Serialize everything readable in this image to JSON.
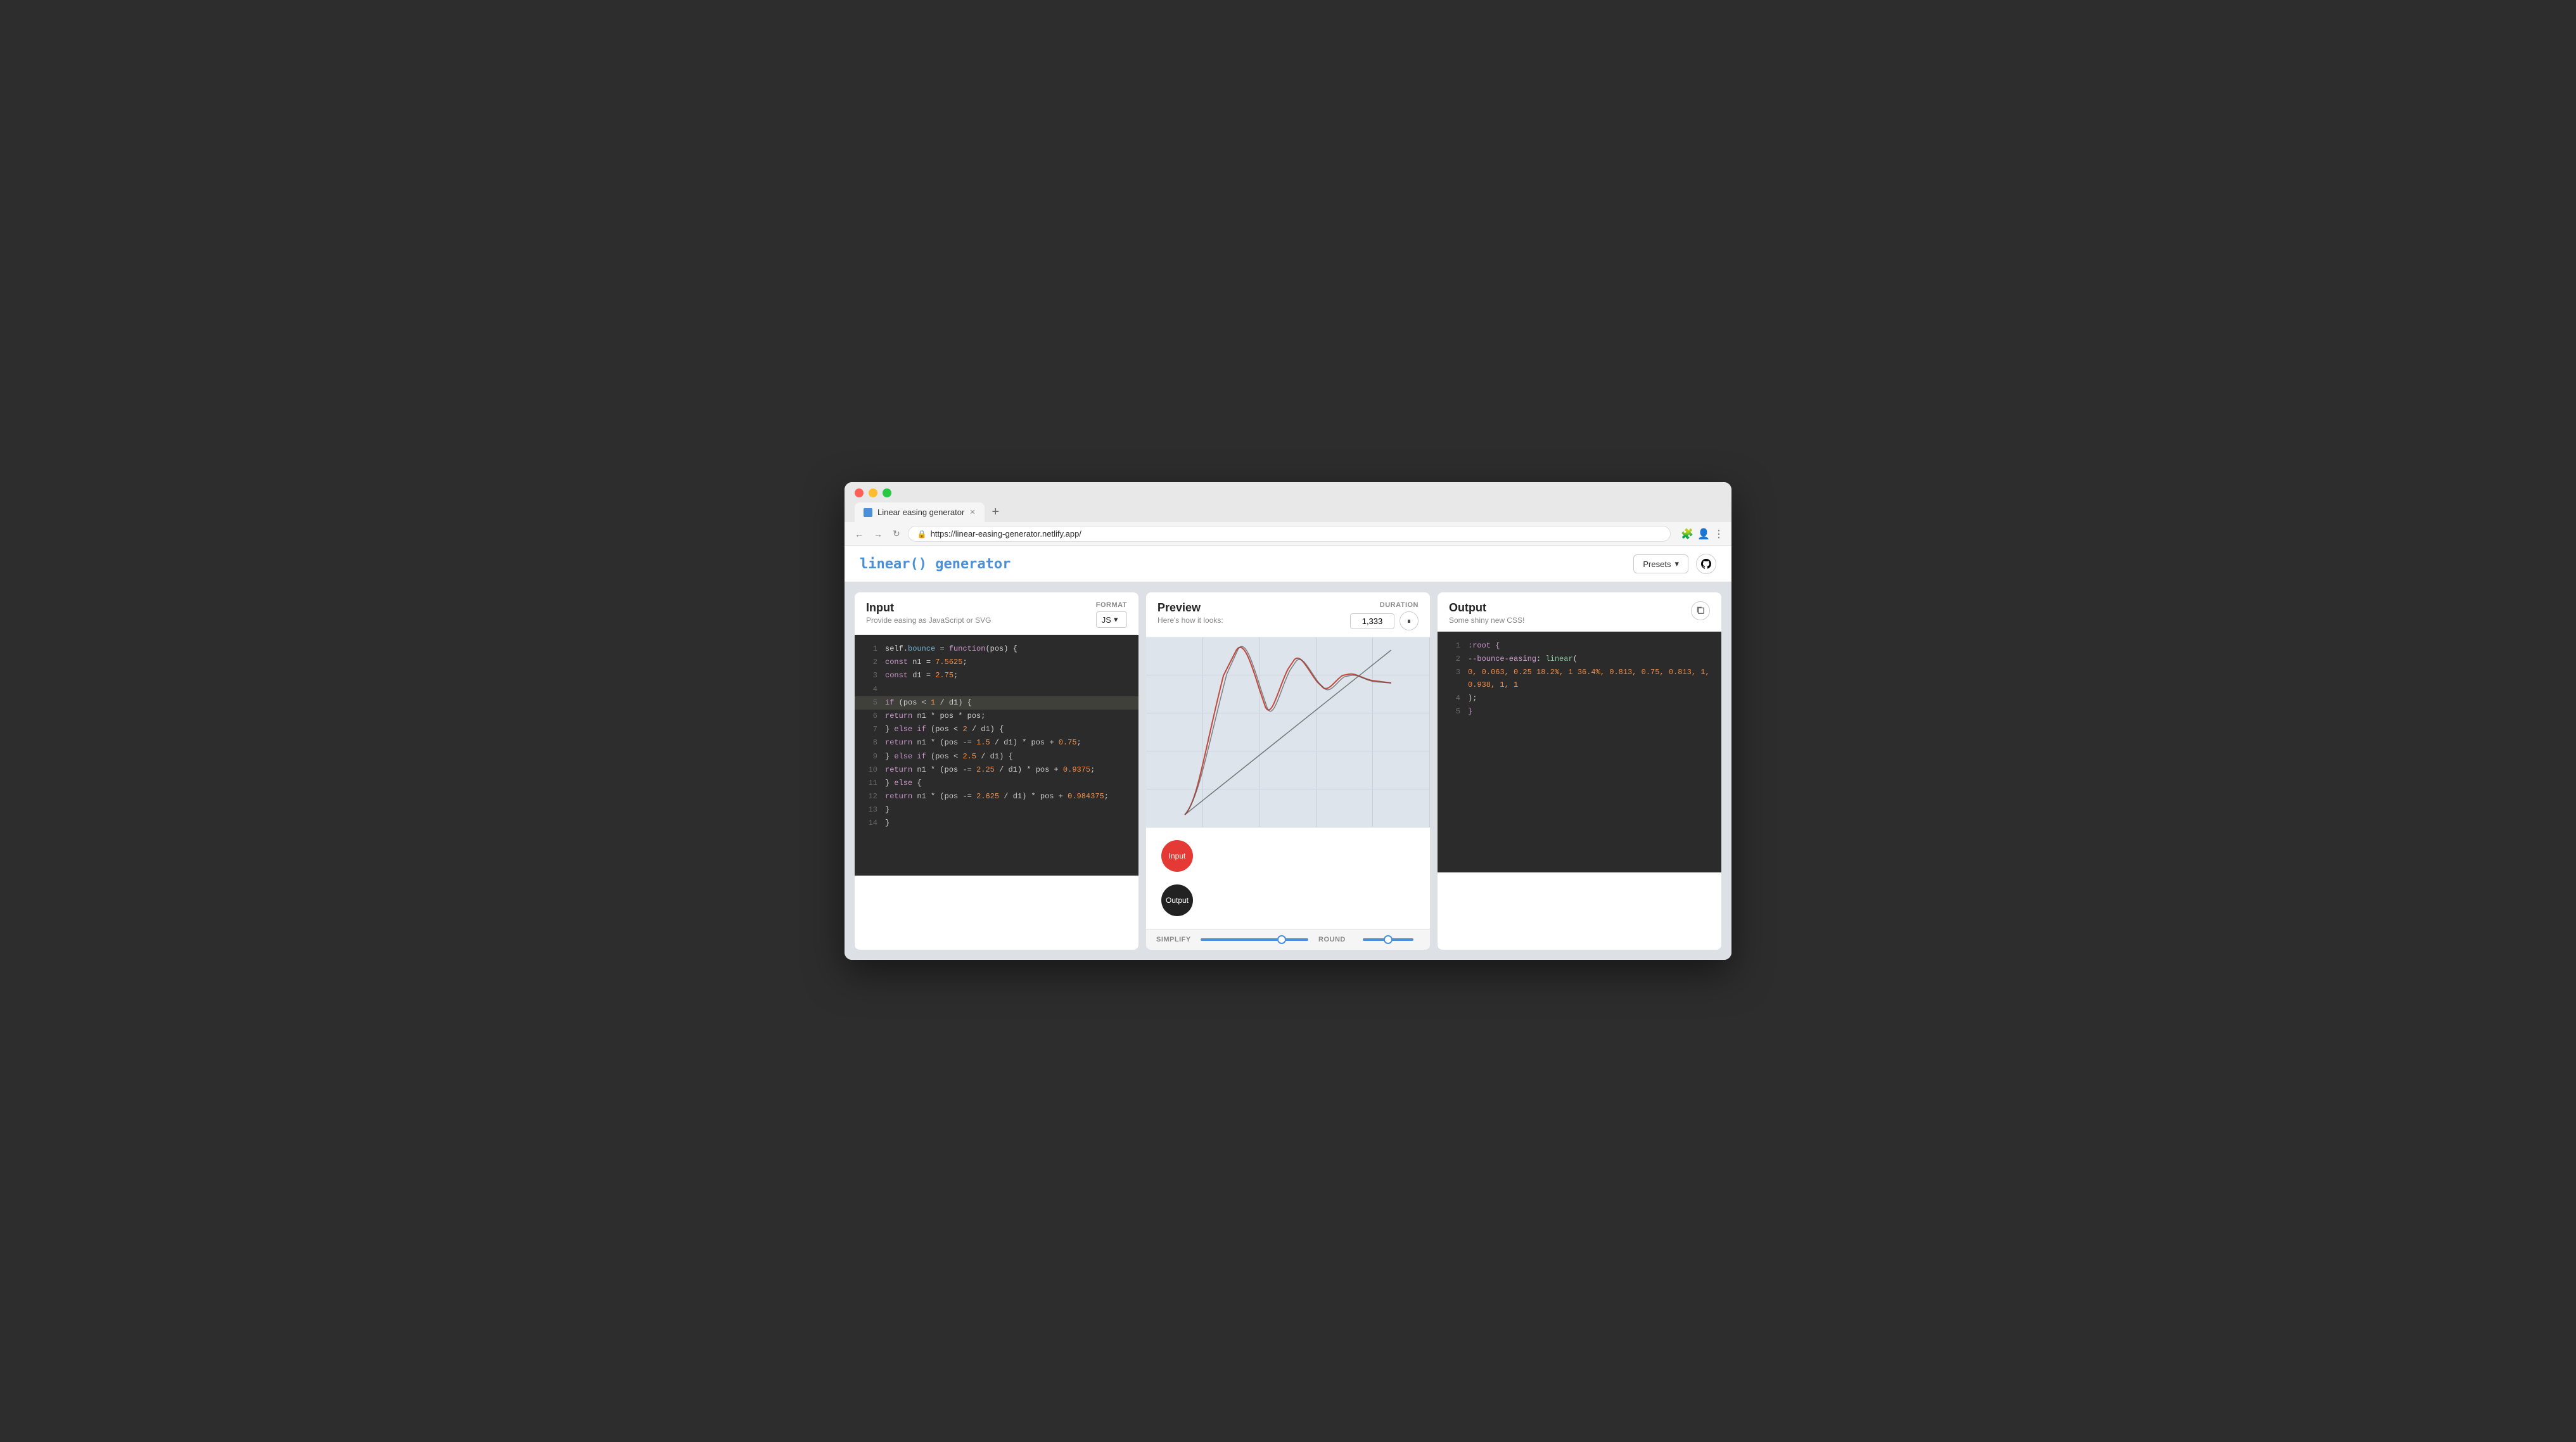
{
  "browser": {
    "tab_title": "Linear easing generator",
    "tab_favicon": "📐",
    "url": "https://linear-easing-generator.netlify.app/",
    "new_tab_icon": "+",
    "back_icon": "←",
    "forward_icon": "→",
    "refresh_icon": "↻",
    "extensions_icon": "🧩",
    "menu_icon": "⋮"
  },
  "header": {
    "logo": "linear() generator",
    "presets_label": "Presets",
    "presets_chevron": "▾",
    "github_icon": "⌥"
  },
  "input_panel": {
    "title": "Input",
    "subtitle": "Provide easing as JavaScript or SVG",
    "format_label": "FORMAT",
    "format_value": "JS",
    "format_chevron": "▾",
    "code_lines": [
      {
        "num": "1",
        "text": "self.bounce = function(pos) {",
        "highlight": false
      },
      {
        "num": "2",
        "text": "  const n1 = 7.5625;",
        "highlight": false
      },
      {
        "num": "3",
        "text": "  const d1 = 2.75;",
        "highlight": false
      },
      {
        "num": "4",
        "text": "",
        "highlight": false
      },
      {
        "num": "5",
        "text": "  if (pos < 1 / d1) {",
        "highlight": true
      },
      {
        "num": "6",
        "text": "    return n1 * pos * pos;",
        "highlight": false
      },
      {
        "num": "7",
        "text": "  } else if (pos < 2 / d1) {",
        "highlight": false
      },
      {
        "num": "8",
        "text": "    return n1 * (pos -= 1.5 / d1) * pos + 0.75;",
        "highlight": false
      },
      {
        "num": "9",
        "text": "  } else if (pos < 2.5 / d1) {",
        "highlight": false
      },
      {
        "num": "10",
        "text": "    return n1 * (pos -= 2.25 / d1) * pos + 0.9375;",
        "highlight": false
      },
      {
        "num": "11",
        "text": "  } else {",
        "highlight": false
      },
      {
        "num": "12",
        "text": "    return n1 * (pos -= 2.625 / d1) * pos + 0.984375;",
        "highlight": false
      },
      {
        "num": "13",
        "text": "  }",
        "highlight": false
      },
      {
        "num": "14",
        "text": "}",
        "highlight": false
      }
    ]
  },
  "preview_panel": {
    "title": "Preview",
    "subtitle": "Here's how it looks:",
    "duration_label": "DURATION",
    "duration_value": "1,333",
    "pause_icon": "⏸",
    "input_ball_label": "Input",
    "output_ball_label": "Output"
  },
  "bottom_controls": {
    "simplify_label": "SIMPLIFY",
    "simplify_value": 75,
    "round_label": "ROUND",
    "round_value": 50
  },
  "output_panel": {
    "title": "Output",
    "subtitle": "Some shiny new CSS!",
    "copy_icon": "⧉",
    "code_lines": [
      {
        "num": "1",
        "text": ":root {",
        "color": "white"
      },
      {
        "num": "2",
        "text": "  --bounce-easing: linear(",
        "color": "green"
      },
      {
        "num": "3",
        "text": "    0, 0.063, 0.25 18.2%, 1 36.4%, 0.813, 0.75, 0.813, 1, 0.938, 1, 1",
        "color": "orange"
      },
      {
        "num": "4",
        "text": "  );",
        "color": "white"
      },
      {
        "num": "5",
        "text": "}",
        "color": "white"
      }
    ]
  }
}
